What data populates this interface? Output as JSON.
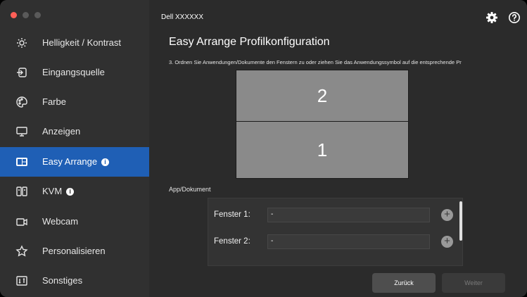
{
  "window": {
    "title": "Dell XXXXXX",
    "colors": {
      "close": "#ff5f57",
      "minimize": "#5a5a5a",
      "maximize": "#5a5a5a",
      "accent": "#1f5fb5"
    }
  },
  "sidebar": {
    "items": [
      {
        "label": "Helligkeit / Kontrast",
        "icon": "brightness-icon"
      },
      {
        "label": "Eingangsquelle",
        "icon": "input-source-icon"
      },
      {
        "label": "Farbe",
        "icon": "color-palette-icon"
      },
      {
        "label": "Anzeigen",
        "icon": "display-icon"
      },
      {
        "label": "Easy Arrange",
        "icon": "easy-arrange-icon",
        "active": true,
        "info": "i"
      },
      {
        "label": "KVM",
        "icon": "kvm-icon",
        "info": "i"
      },
      {
        "label": "Webcam",
        "icon": "webcam-icon"
      },
      {
        "label": "Personalisieren",
        "icon": "star-icon"
      },
      {
        "label": "Sonstiges",
        "icon": "others-icon"
      }
    ]
  },
  "main": {
    "title": "Easy Arrange Profilkonfiguration",
    "instruction": "3. Ordnen Sie Anwendungen/Dokumente den Fenstern zu oder ziehen Sie das Anwendungssymbol auf die entsprechende Pr",
    "zones": [
      {
        "label": "2"
      },
      {
        "label": "1"
      }
    ],
    "app_section_label": "App/Dokument",
    "windows": [
      {
        "label": "Fenster 1:",
        "value": "-",
        "add": "+"
      },
      {
        "label": "Fenster 2:",
        "value": "-",
        "add": "+"
      }
    ],
    "buttons": {
      "back": "Zurück",
      "next": "Weiter"
    }
  }
}
